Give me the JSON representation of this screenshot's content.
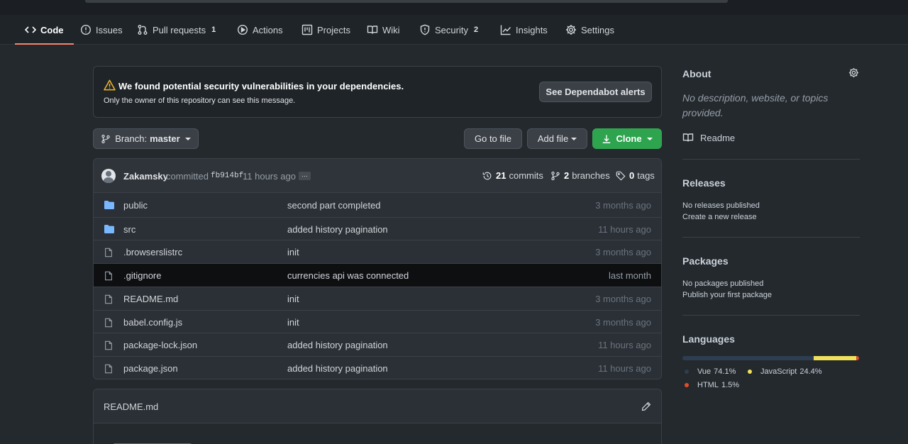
{
  "tabs": [
    {
      "label": "Code",
      "icon": "code-icon",
      "count": ""
    },
    {
      "label": "Issues",
      "icon": "issue-icon",
      "count": ""
    },
    {
      "label": "Pull requests",
      "icon": "pull-request-icon",
      "count": "1"
    },
    {
      "label": "Actions",
      "icon": "play-icon",
      "count": ""
    },
    {
      "label": "Projects",
      "icon": "project-icon",
      "count": ""
    },
    {
      "label": "Wiki",
      "icon": "book-icon",
      "count": ""
    },
    {
      "label": "Security",
      "icon": "shield-icon",
      "count": "2"
    },
    {
      "label": "Insights",
      "icon": "graph-icon",
      "count": ""
    },
    {
      "label": "Settings",
      "icon": "gear-icon",
      "count": ""
    }
  ],
  "alert": {
    "message": "We found potential security vulnerabilities in your dependencies.",
    "sub": "Only the owner of this repository can see this message.",
    "button": "See Dependabot alerts"
  },
  "toolbar": {
    "branch_prefix": "Branch:",
    "branch_name": "master",
    "goto_label": "Go to file",
    "addfile_label": "Add file",
    "clone_label": "Clone"
  },
  "commit": {
    "author": "Zakamsky",
    "verb": "committed",
    "sha": "fb914bf",
    "time": "11 hours ago",
    "more": "…",
    "commits_count": "21",
    "commits_label": "commits",
    "branches_count": "2",
    "branches_label": "branches",
    "tags_count": "0",
    "tags_label": "tags"
  },
  "files": [
    {
      "name": "public",
      "type": "dir",
      "message": "second part completed",
      "age": "3 months ago"
    },
    {
      "name": "src",
      "type": "dir",
      "message": "added history pagination",
      "age": "11 hours ago"
    },
    {
      "name": ".browserslistrc",
      "type": "file",
      "message": "init",
      "age": "3 months ago"
    },
    {
      "name": ".gitignore",
      "type": "file",
      "message": "currencies api was connected",
      "age": "last month"
    },
    {
      "name": "README.md",
      "type": "file",
      "message": "init",
      "age": "3 months ago"
    },
    {
      "name": "babel.config.js",
      "type": "file",
      "message": "init",
      "age": "3 months ago"
    },
    {
      "name": "package-lock.json",
      "type": "file",
      "message": "added history pagination",
      "age": "11 hours ago"
    },
    {
      "name": "package.json",
      "type": "file",
      "message": "added history pagination",
      "age": "11 hours ago"
    }
  ],
  "readme": {
    "title": "README.md"
  },
  "sidebar": {
    "about_title": "About",
    "about_desc": "No description, website, or topics provided.",
    "readme_link": "Readme",
    "releases_title": "Releases",
    "releases_none": "No releases published",
    "releases_link": "Create a new release",
    "packages_title": "Packages",
    "packages_none": "No packages published",
    "packages_link": "Publish your first package",
    "languages_title": "Languages",
    "languages": [
      {
        "name": "Vue",
        "percent": "74.1%",
        "value": 74.1,
        "color": "#2c3e50"
      },
      {
        "name": "JavaScript",
        "percent": "24.4%",
        "value": 24.4,
        "color": "#f1e05a"
      },
      {
        "name": "HTML",
        "percent": "1.5%",
        "value": 1.5,
        "color": "#e34c26"
      }
    ]
  },
  "colors": {
    "accent_tab": "#f9826c",
    "clone_green": "#2ea44f",
    "folder_blue": "#79b8ff"
  }
}
